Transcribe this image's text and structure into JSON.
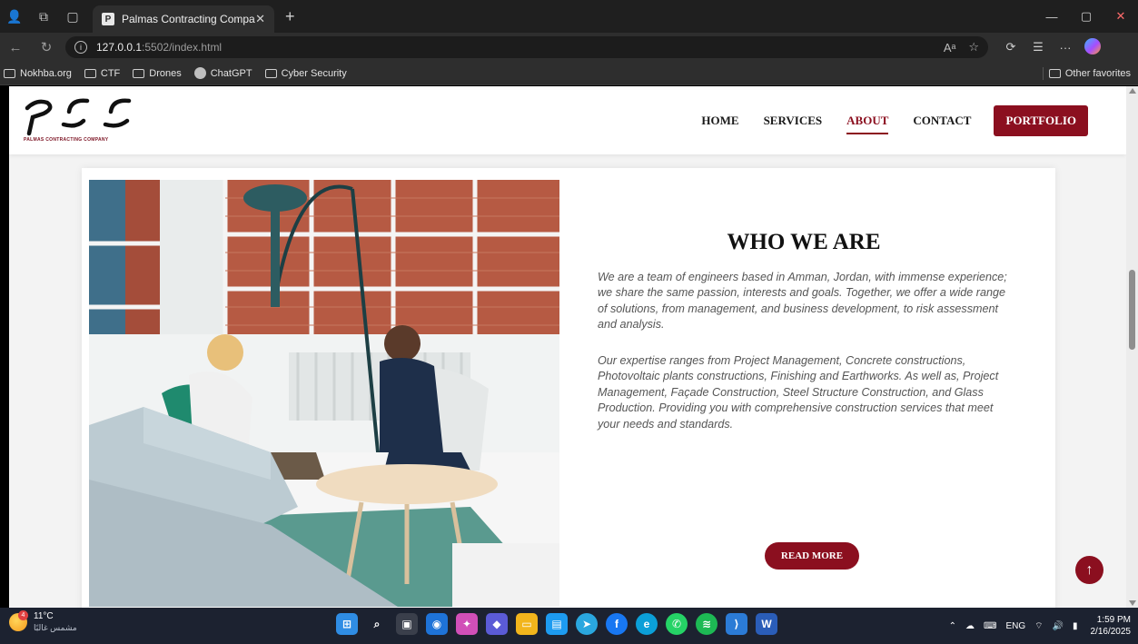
{
  "browser": {
    "tab_title": "Palmas Contracting Company",
    "tab_favicon": "P",
    "url_host": "127.0.0.1",
    "url_path": ":5502/index.html",
    "bookmarks": [
      "Nokhba.org",
      "CTF",
      "Drones",
      "ChatGPT",
      "Cyber Security"
    ],
    "other_favorites": "Other favorites"
  },
  "site": {
    "logo_tagline": "PALMAS CONTRACTING COMPANY",
    "nav": {
      "home": "HOME",
      "services": "SERVICES",
      "about": "ABOUT",
      "contact": "CONTACT",
      "portfolio": "PORTFOLIO"
    },
    "about": {
      "heading": "WHO WE ARE",
      "paragraph1": "We are a team of engineers based in Amman, Jordan, with immense experience; we share the same passion, interests and goals. Together, we offer a wide range of solutions, from management, and business development, to risk assessment and analysis.",
      "paragraph2": "Our expertise ranges from Project Management, Concrete constructions, Photovoltaic plants constructions, Finishing and Earthworks. As well as, Project Management, Façade Construction, Steel Structure Construction, and Glass Production. Providing you with comprehensive construction services that meet your needs and standards.",
      "read_more": "READ MORE"
    },
    "accent_color": "#8b0f1f"
  },
  "taskbar": {
    "temperature": "11°C",
    "weather_desc": "مشمس غالبًا",
    "weather_badge": "4",
    "language": "ENG",
    "time": "1:59 PM",
    "date": "2/16/2025"
  }
}
